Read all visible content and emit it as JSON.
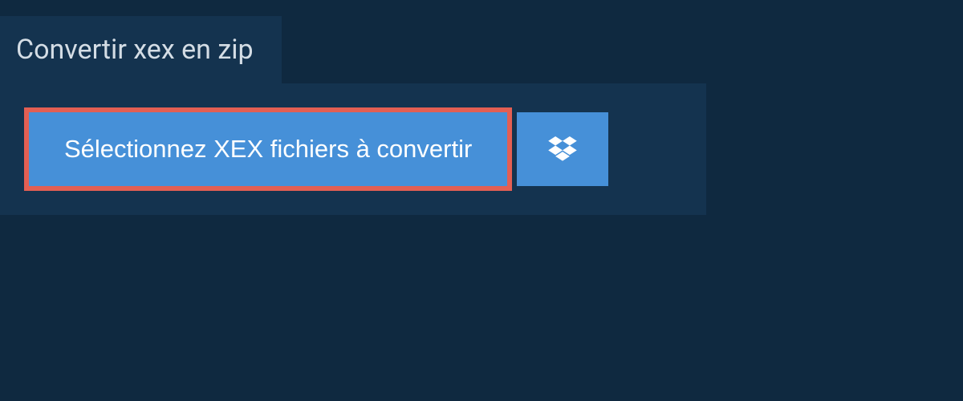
{
  "header": {
    "title": "Convertir xex en zip"
  },
  "actions": {
    "select_files_label": "Sélectionnez XEX fichiers à convertir"
  },
  "colors": {
    "background": "#0f2940",
    "panel": "#14334f",
    "button": "#4690d8",
    "highlight_border": "#e35f53",
    "text_light": "#d4dde5",
    "text_white": "#ffffff"
  }
}
